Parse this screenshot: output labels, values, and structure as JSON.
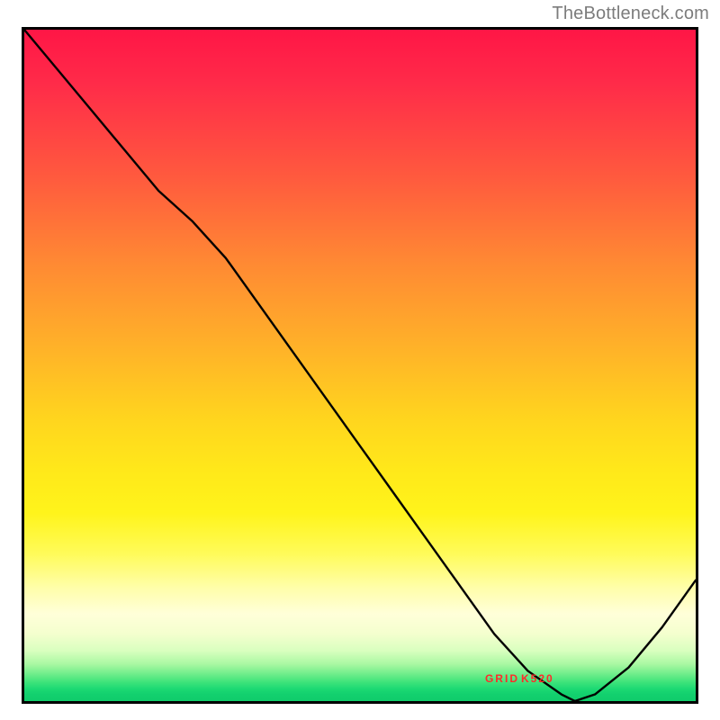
{
  "attribution": "TheBottleneck.com",
  "series_label": "GRID K520",
  "series_label_color": "#ff2a2a",
  "chart_data": {
    "type": "line",
    "title": "",
    "xlabel": "",
    "ylabel": "",
    "xlim": [
      0,
      100
    ],
    "ylim": [
      0,
      100
    ],
    "x": [
      0,
      5,
      10,
      15,
      20,
      25,
      30,
      35,
      40,
      45,
      50,
      55,
      60,
      65,
      70,
      75,
      80,
      82,
      85,
      90,
      95,
      100
    ],
    "values": [
      100,
      94,
      88,
      82,
      76,
      71.5,
      66,
      59,
      52,
      45,
      38,
      31,
      24,
      17,
      10,
      4.5,
      1,
      0,
      1,
      5,
      11,
      18
    ],
    "series_name": "GRID K520",
    "label_position_x": 76,
    "label_position_y": 2.3,
    "background": "heatmap-gradient-red-to-green"
  }
}
